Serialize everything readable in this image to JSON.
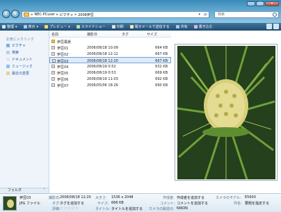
{
  "window": {
    "buttons": [
      "_",
      "□",
      "x"
    ]
  },
  "address": {
    "crumbs": [
      "NEC-PCuser",
      "ピクチャ",
      "2006伊豆"
    ],
    "separator": "▸"
  },
  "search": {
    "placeholder": "検索"
  },
  "toolbar": {
    "organize": "整理",
    "views": "表示",
    "preview": "プレビュー",
    "slideshow": "スライドショー",
    "print": "印刷",
    "email": "電子メールで送信する",
    "share": "共有",
    "burn": "書き込む"
  },
  "navpane": {
    "heading": "お気に入りリンク",
    "links": [
      "ピクチャ",
      "検索",
      "ドキュメント",
      "ミュージック",
      "最近の変更"
    ],
    "folders_label": "フォルダ"
  },
  "columns": {
    "name": "名前",
    "date": "撮影日",
    "tags": "タグ",
    "size": "サイズ"
  },
  "files": [
    {
      "name": "伊豆風景",
      "date": "",
      "size": "",
      "type": "folder"
    },
    {
      "name": "伊豆01",
      "date": "2006/08/18 10:09",
      "size": "664 KB",
      "type": "image"
    },
    {
      "name": "伊豆02",
      "date": "2006/08/18 12:12",
      "size": "667 KB",
      "type": "image"
    },
    {
      "name": "伊豆03",
      "date": "2006/08/18 12:20",
      "size": "667 KB",
      "type": "image",
      "selected": true
    },
    {
      "name": "伊豆04",
      "date": "2006/08/19 0:52",
      "size": "632 KB",
      "type": "image"
    },
    {
      "name": "伊豆05",
      "date": "2006/08/19 0:53",
      "size": "669 KB",
      "type": "image"
    },
    {
      "name": "伊豆06",
      "date": "2006/08/19 11:03",
      "size": "692 KB",
      "type": "image"
    },
    {
      "name": "伊豆07",
      "date": "2006/05/06 18:26",
      "size": "690 KB",
      "type": "image"
    }
  ],
  "details": {
    "filename": "伊豆03",
    "filetype": "JPG ファイル",
    "date_label": "撮影日:",
    "date_value": "2006/08/18 12:20",
    "tags_label": "タグ:",
    "tags_value": "タグを追加する",
    "rating_label": "評価:",
    "dimensions_label": "大きさ:",
    "dimensions_value": "1536 x 2048",
    "size_label": "サイズ:",
    "size_value": "666 KB",
    "title_label": "タイトル:",
    "title_value": "タイトルを追加する",
    "author_label": "作成者:",
    "author_value": "作成者を追加する",
    "comment_label": "コメント:",
    "comment_value": "コメントを追加する",
    "maker_label": "カメラの製造元:",
    "maker_value": "NIKON",
    "model_label": "カメラのモデル:",
    "model_value": "E5600",
    "subject_label": "件名:",
    "subject_value": "要題を指定する"
  },
  "colors": {
    "accent": "#1f4d73",
    "selection": "#dcebfc",
    "link": "#2452a8"
  }
}
